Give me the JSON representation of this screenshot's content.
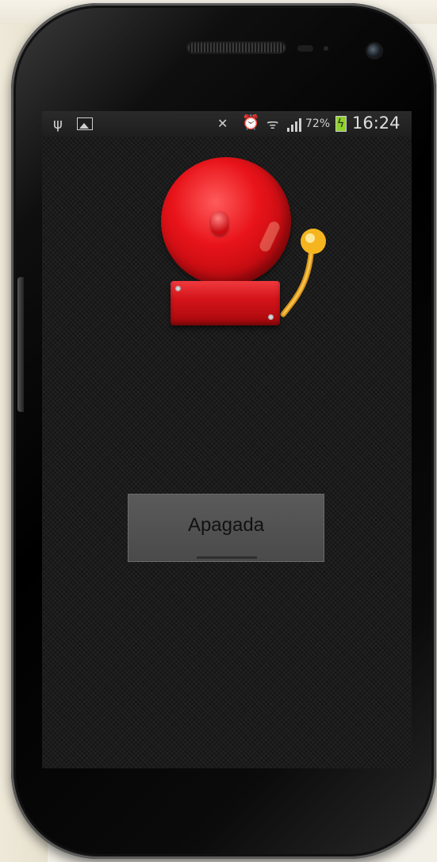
{
  "status_bar": {
    "battery_percent": "72%",
    "time": "16:24",
    "icons": [
      "usb-icon",
      "image-notification-icon",
      "mute-icon",
      "alarm-icon",
      "wifi-icon",
      "signal-icon",
      "battery-charging-icon"
    ],
    "battery_color": "#8fd12b"
  },
  "main": {
    "illustration": "alarm-bell",
    "toggle_button": {
      "label": "Apagada",
      "state": "off"
    }
  },
  "colors": {
    "bell_red": "#e8141a",
    "arm_gold": "#f5b51f",
    "screen_bg": "#1b1b1b"
  }
}
